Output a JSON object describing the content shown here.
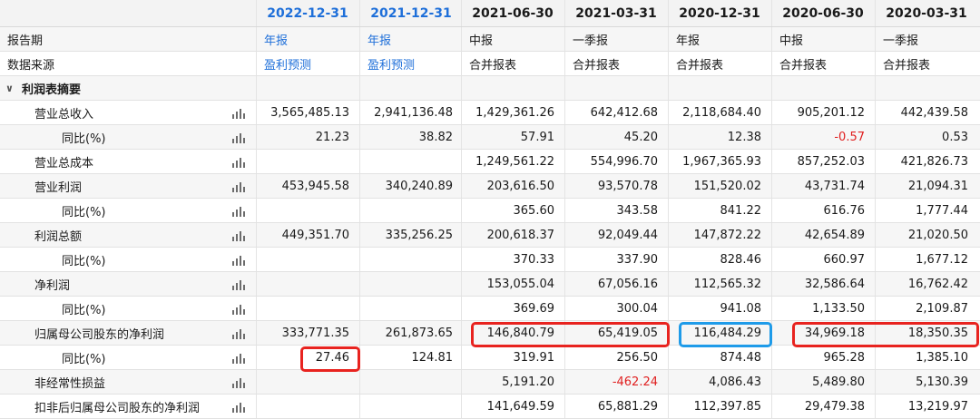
{
  "columns": [
    {
      "date": "2022-12-31",
      "highlight": true
    },
    {
      "date": "2021-12-31",
      "highlight": true
    },
    {
      "date": "2021-06-30",
      "highlight": false
    },
    {
      "date": "2021-03-31",
      "highlight": false
    },
    {
      "date": "2020-12-31",
      "highlight": false
    },
    {
      "date": "2020-06-30",
      "highlight": false
    },
    {
      "date": "2020-03-31",
      "highlight": false
    }
  ],
  "rows": [
    {
      "id": "report-period",
      "label": "报告期",
      "level": 0,
      "kind": "text",
      "icon": false,
      "values": [
        "年报",
        "年报",
        "中报",
        "一季报",
        "年报",
        "中报",
        "一季报"
      ]
    },
    {
      "id": "data-source",
      "label": "数据来源",
      "level": 0,
      "kind": "text",
      "icon": false,
      "values": [
        "盈利预测",
        "盈利预测",
        "合并报表",
        "合并报表",
        "合并报表",
        "合并报表",
        "合并报表"
      ]
    },
    {
      "id": "income-summary",
      "label": "利润表摘要",
      "level": 0,
      "kind": "group",
      "icon": false,
      "values": []
    },
    {
      "id": "total-revenue",
      "label": "营业总收入",
      "level": 1,
      "kind": "num",
      "icon": true,
      "values": [
        "3,565,485.13",
        "2,941,136.48",
        "1,429,361.26",
        "642,412.68",
        "2,118,684.40",
        "905,201.12",
        "442,439.58"
      ]
    },
    {
      "id": "total-revenue-yoy",
      "label": "同比(%)",
      "level": 2,
      "kind": "num",
      "icon": true,
      "values": [
        "21.23",
        "38.82",
        "57.91",
        "45.20",
        "12.38",
        "-0.57",
        "0.53"
      ]
    },
    {
      "id": "total-cost",
      "label": "营业总成本",
      "level": 1,
      "kind": "num",
      "icon": true,
      "values": [
        "",
        "",
        "1,249,561.22",
        "554,996.70",
        "1,967,365.93",
        "857,252.03",
        "421,826.73"
      ]
    },
    {
      "id": "operating-profit",
      "label": "营业利润",
      "level": 1,
      "kind": "num",
      "icon": true,
      "values": [
        "453,945.58",
        "340,240.89",
        "203,616.50",
        "93,570.78",
        "151,520.02",
        "43,731.74",
        "21,094.31"
      ]
    },
    {
      "id": "operating-profit-yoy",
      "label": "同比(%)",
      "level": 2,
      "kind": "num",
      "icon": true,
      "values": [
        "",
        "",
        "365.60",
        "343.58",
        "841.22",
        "616.76",
        "1,777.44"
      ]
    },
    {
      "id": "total-profit",
      "label": "利润总额",
      "level": 1,
      "kind": "num",
      "icon": true,
      "values": [
        "449,351.70",
        "335,256.25",
        "200,618.37",
        "92,049.44",
        "147,872.22",
        "42,654.89",
        "21,020.50"
      ]
    },
    {
      "id": "total-profit-yoy",
      "label": "同比(%)",
      "level": 2,
      "kind": "num",
      "icon": true,
      "values": [
        "",
        "",
        "370.33",
        "337.90",
        "828.46",
        "660.97",
        "1,677.12"
      ]
    },
    {
      "id": "net-profit",
      "label": "净利润",
      "level": 1,
      "kind": "num",
      "icon": true,
      "values": [
        "",
        "",
        "153,055.04",
        "67,056.16",
        "112,565.32",
        "32,586.64",
        "16,762.42"
      ]
    },
    {
      "id": "net-profit-yoy",
      "label": "同比(%)",
      "level": 2,
      "kind": "num",
      "icon": true,
      "values": [
        "",
        "",
        "369.69",
        "300.04",
        "941.08",
        "1,133.50",
        "2,109.87"
      ]
    },
    {
      "id": "parent-net-profit",
      "label": "归属母公司股东的净利润",
      "level": 1,
      "kind": "num",
      "icon": true,
      "values": [
        "333,771.35",
        "261,873.65",
        "146,840.79",
        "65,419.05",
        "116,484.29",
        "34,969.18",
        "18,350.35"
      ]
    },
    {
      "id": "parent-net-profit-yoy",
      "label": "同比(%)",
      "level": 2,
      "kind": "num",
      "icon": true,
      "values": [
        "27.46",
        "124.81",
        "319.91",
        "256.50",
        "874.48",
        "965.28",
        "1,385.10"
      ]
    },
    {
      "id": "non-recurring",
      "label": "非经常性损益",
      "level": 1,
      "kind": "num",
      "icon": true,
      "values": [
        "",
        "",
        "5,191.20",
        "-462.24",
        "4,086.43",
        "5,489.80",
        "5,130.39"
      ]
    },
    {
      "id": "deducted-net-profit",
      "label": "扣非后归属母公司股东的净利润",
      "level": 1,
      "kind": "num",
      "icon": true,
      "values": [
        "",
        "",
        "141,649.59",
        "65,881.29",
        "112,397.85",
        "29,479.38",
        "13,219.97"
      ]
    }
  ],
  "colors": {
    "accent_blue": "#1e6fd9",
    "negative": "#e02020",
    "box_red": "#e8231f",
    "box_blue": "#1e9be9"
  }
}
